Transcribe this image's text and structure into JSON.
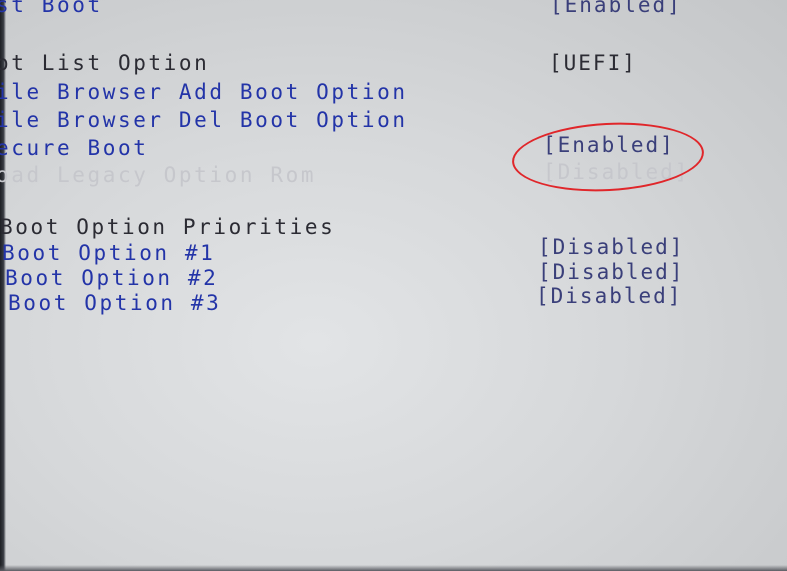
{
  "settings": [
    {
      "label": "st Boot",
      "value": "[Enabled]"
    },
    {
      "label": "ot List Option",
      "value": "[UEFI]"
    },
    {
      "label": "ile Browser Add Boot Option",
      "value": ""
    },
    {
      "label": "ile Browser Del Boot Option",
      "value": ""
    },
    {
      "label": "ecure Boot",
      "value": "[Enabled]"
    },
    {
      "label": "oad Legacy Option Rom",
      "value": "[Disabled]"
    }
  ],
  "priorities": {
    "heading": "Boot Option Priorities",
    "items": [
      {
        "label": "Boot Option #1",
        "value": "[Disabled]"
      },
      {
        "label": "Boot Option #2",
        "value": "[Disabled]"
      },
      {
        "label": "Boot Option #3",
        "value": "[Disabled]"
      }
    ]
  },
  "colors": {
    "option_text": "#2334a8",
    "heading_text": "#2b2b33",
    "disabled_text": "#c6c7cc",
    "annotation_circle": "#e0262a",
    "background": "#d6d8da"
  }
}
